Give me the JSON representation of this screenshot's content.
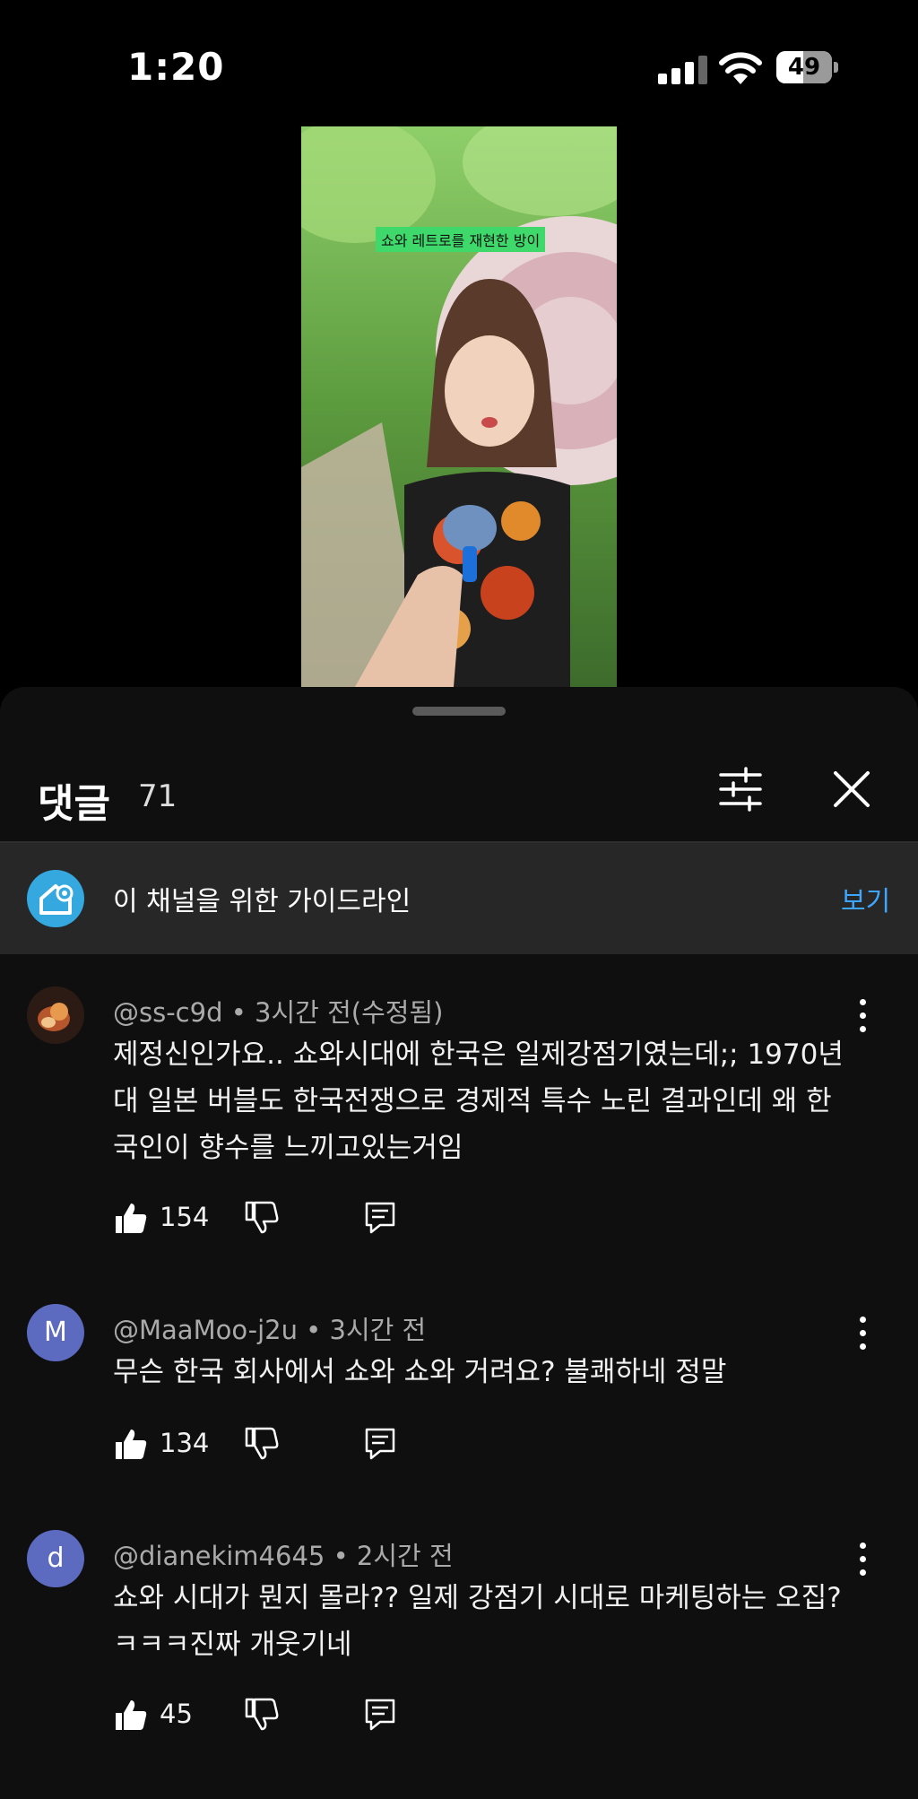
{
  "status_bar": {
    "time": "1:20",
    "battery": "49",
    "battery_level": 0.49
  },
  "video": {
    "caption": "쇼와 레트로를 재현한 방이"
  },
  "comments_panel": {
    "title": "댓글",
    "count": "71",
    "guideline_text": "이 채널을 위한 가이드라인",
    "guideline_action": "보기"
  },
  "comments": [
    {
      "author": "@ss-c9d",
      "time": "3시간 전(수정됨)",
      "avatar_letter": "",
      "text": "제정신인가요.. 쇼와시대에 한국은 일제강점기였는데;; 1970년대 일본 버블도 한국전쟁으로 경제적 특수 노린 결과인데 왜 한국인이 향수를 느끼고있는거임",
      "likes": "154"
    },
    {
      "author": "@MaaMoo-j2u",
      "time": "3시간 전",
      "avatar_letter": "M",
      "avatar_color": "#5c6bc0",
      "text": "무슨 한국 회사에서 쇼와 쇼와 거려요? 불쾌하네 정말",
      "likes": "134"
    },
    {
      "author": "@dianekim4645",
      "time": "2시간 전",
      "avatar_letter": "d",
      "avatar_color": "#5c6bc0",
      "text": "쇼와 시대가 뭔지 몰라?? 일제 강점기 시대로 마케팅하는 오집? ㅋㅋㅋ진짜 개웃기네",
      "likes": "45"
    }
  ],
  "icons": {
    "filter": "sliders-icon",
    "close": "close-icon",
    "guideline": "house-heart-icon",
    "like": "thumbs-up-icon",
    "dislike": "thumbs-down-icon",
    "reply": "comment-icon",
    "more": "more-vertical-icon"
  }
}
